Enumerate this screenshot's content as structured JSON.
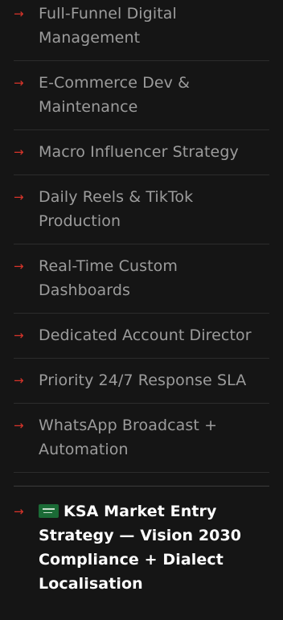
{
  "features": {
    "arrow_glyph": "→",
    "accent_color": "#d8342a",
    "items": [
      {
        "label": "Full-Funnel Digital Management"
      },
      {
        "label": "E-Commerce Dev & Maintenance"
      },
      {
        "label": "Macro Influencer Strategy"
      },
      {
        "label": "Daily Reels & TikTok Production"
      },
      {
        "label": "Real-Time Custom Dashboards"
      },
      {
        "label": "Dedicated Account Director"
      },
      {
        "label": "Priority 24/7 Response SLA"
      },
      {
        "label": "WhatsApp Broadcast + Automation"
      }
    ],
    "highlight": {
      "flag_icon": "saudi-arabia-flag-icon",
      "label": "KSA Market Entry Strategy — Vision 2030 Compliance + Dialect Localisation"
    }
  }
}
